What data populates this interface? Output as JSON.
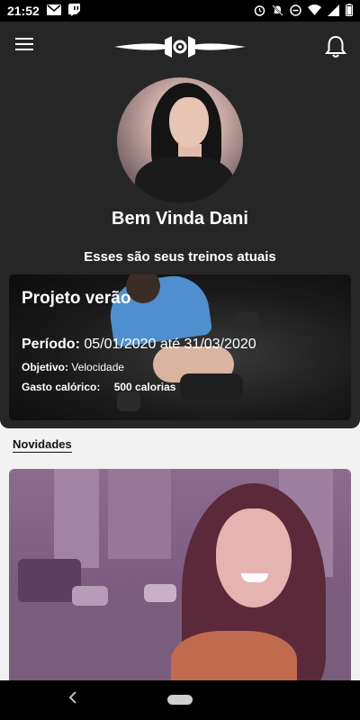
{
  "status_bar": {
    "time": "21:52",
    "left_icons": [
      "mail-icon",
      "twitch-icon"
    ],
    "right_icons": [
      "alarm-icon",
      "mute-icon",
      "dnd-icon",
      "wifi-icon",
      "signal-icon",
      "battery-icon"
    ]
  },
  "header": {
    "menu_icon": "hamburger-icon",
    "logo_icon": "dumbbell-logo-icon",
    "notification_icon": "bell-icon",
    "welcome": "Bem Vinda Dani",
    "subtitle": "Esses são seus treinos atuais"
  },
  "training_card": {
    "title": "Projeto verão",
    "period_label": "Período:",
    "period_value": "05/01/2020 até 31/03/2020",
    "objective_label": "Objetivo:",
    "objective_value": "Velocidade",
    "calories_label": "Gasto calórico:",
    "calories_value": "500 calorias"
  },
  "news": {
    "section_title": "Novidades"
  },
  "nav_bar": {
    "back_icon": "back-icon",
    "home_icon": "home-pill-icon"
  },
  "colors": {
    "header_bg": "#262626",
    "page_bg": "#f2f2f2",
    "text_light": "#ffffff",
    "text_dark": "#111111"
  }
}
